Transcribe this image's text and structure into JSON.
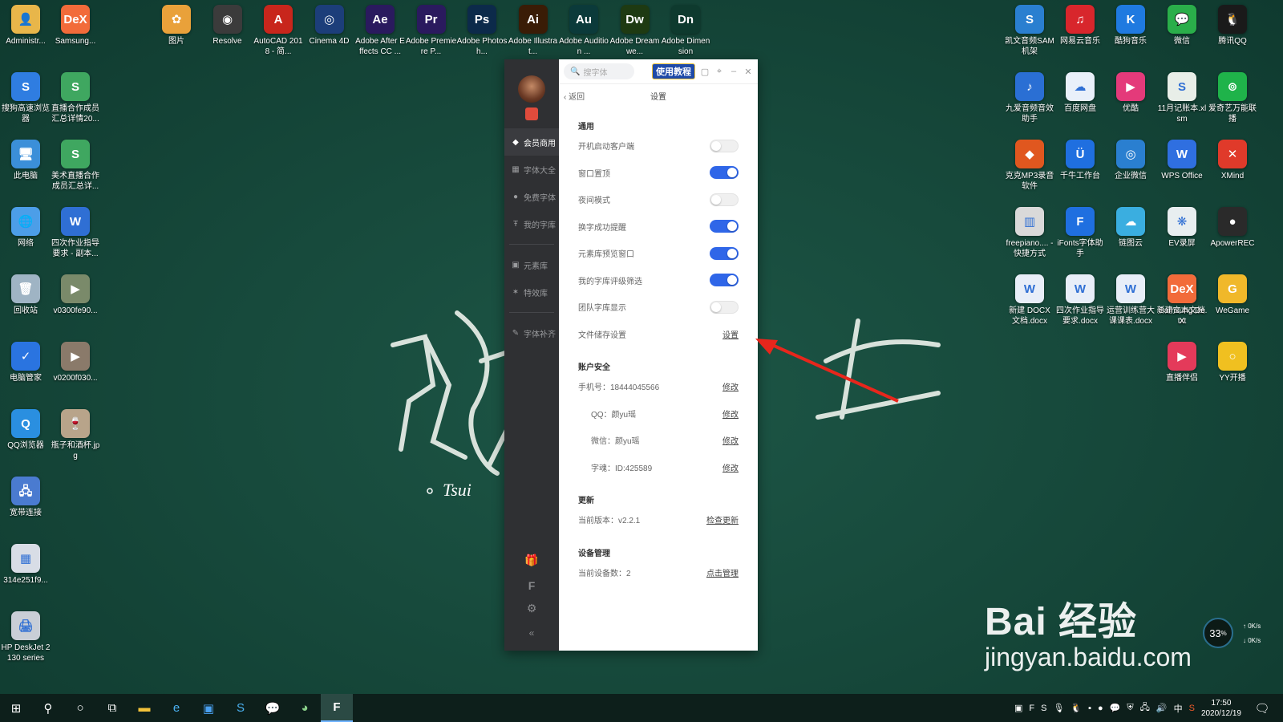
{
  "desktop": {
    "left_icons": [
      {
        "label": "Administr...",
        "color": "#e8b64a",
        "glyph": "👤",
        "icon": "user-folder-icon"
      },
      {
        "label": "Samsung...",
        "color": "#f26b3a",
        "glyph": "DeX",
        "icon": "samsung-dex-icon"
      },
      {
        "label": "搜狗高速浏览器",
        "color": "#2f7de1",
        "glyph": "S",
        "icon": "sogou-browser-icon"
      },
      {
        "label": "直播合作成员汇总详情20...",
        "color": "#3fa760",
        "glyph": "S",
        "icon": "spreadsheet-icon"
      },
      {
        "label": "此电脑",
        "color": "#3b8fd9",
        "glyph": "🖥",
        "icon": "this-pc-icon"
      },
      {
        "label": "美术直播合作成员汇总详...",
        "color": "#3fa760",
        "glyph": "S",
        "icon": "spreadsheet-icon"
      },
      {
        "label": "网络",
        "color": "#4c9ee8",
        "glyph": "🌐",
        "icon": "network-icon"
      },
      {
        "label": "四次作业指导要求 - 副本...",
        "color": "#2f6fd4",
        "glyph": "W",
        "icon": "word-doc-icon"
      },
      {
        "label": "回收站",
        "color": "#9fb4c4",
        "glyph": "🗑",
        "icon": "recycle-bin-icon"
      },
      {
        "label": "v0300fe90...",
        "color": "#7a8a6a",
        "glyph": "▶",
        "icon": "video-file-icon"
      },
      {
        "label": "电脑管家",
        "color": "#2a74e0",
        "glyph": "✓",
        "icon": "pc-manager-icon"
      },
      {
        "label": "v0200f030...",
        "color": "#8a7a6a",
        "glyph": "▶",
        "icon": "video-file-icon"
      },
      {
        "label": "QQ浏览器",
        "color": "#2a8fe0",
        "glyph": "Q",
        "icon": "qq-browser-icon"
      },
      {
        "label": "瓶子和酒杯.jpg",
        "color": "#b8a48a",
        "glyph": "🍷",
        "icon": "image-file-icon"
      },
      {
        "label": "宽带连接",
        "color": "#4a7bd0",
        "glyph": "🖧",
        "icon": "broadband-icon"
      },
      {
        "label": "314e251f9...",
        "color": "#d8dde6",
        "glyph": "▦",
        "icon": "image-file-icon"
      },
      {
        "label": "HP DeskJet 2130 series",
        "color": "#c9ced6",
        "glyph": "🖨",
        "icon": "printer-icon"
      }
    ],
    "top_icons": [
      {
        "label": "图片",
        "color": "#e9a13a",
        "glyph": "✿",
        "icon": "photos-icon"
      },
      {
        "label": "Resolve",
        "color": "#3b3b3b",
        "glyph": "◉",
        "icon": "davinci-resolve-icon"
      },
      {
        "label": "AutoCAD 2018 - 简...",
        "color": "#c8261c",
        "glyph": "A",
        "icon": "autocad-icon"
      },
      {
        "label": "Cinema 4D",
        "color": "#1c3e7a",
        "glyph": "◎",
        "icon": "cinema4d-icon"
      },
      {
        "label": "Adobe After Effects CC ...",
        "color": "#2a1a5e",
        "glyph": "Ae",
        "icon": "after-effects-icon"
      },
      {
        "label": "Adobe Premiere P...",
        "color": "#2a1a5e",
        "glyph": "Pr",
        "icon": "premiere-icon"
      },
      {
        "label": "Adobe Photosh...",
        "color": "#0c2a4a",
        "glyph": "Ps",
        "icon": "photoshop-icon"
      },
      {
        "label": "Adobe Illustrat...",
        "color": "#3a1c06",
        "glyph": "Ai",
        "icon": "illustrator-icon"
      },
      {
        "label": "Adobe Audition ...",
        "color": "#0b3a3a",
        "glyph": "Au",
        "icon": "audition-icon"
      },
      {
        "label": "Adobe Dreamwe...",
        "color": "#1e3a12",
        "glyph": "Dw",
        "icon": "dreamweaver-icon"
      },
      {
        "label": "Adobe Dimension",
        "color": "#0e3a2e",
        "glyph": "Dn",
        "icon": "dimension-icon"
      }
    ],
    "right_icons": [
      {
        "label": "凯文音频SAM机架",
        "color": "#2a7fd0",
        "glyph": "S",
        "icon": "sam-rack-icon"
      },
      {
        "label": "网易云音乐",
        "color": "#d8262c",
        "glyph": "♫",
        "icon": "netease-music-icon"
      },
      {
        "label": "酷狗音乐",
        "color": "#1f7ae0",
        "glyph": "K",
        "icon": "kugou-icon"
      },
      {
        "label": "微信",
        "color": "#2aae4a",
        "glyph": "💬",
        "icon": "wechat-icon"
      },
      {
        "label": "腾讯QQ",
        "color": "#1a1a1a",
        "glyph": "🐧",
        "icon": "qq-icon"
      },
      {
        "label": "九爱音频音效助手",
        "color": "#2a6fd4",
        "glyph": "♪",
        "icon": "audio-helper-icon"
      },
      {
        "label": "百度网盘",
        "color": "#e9f0fa",
        "glyph": "☁",
        "icon": "baidu-netdisk-icon"
      },
      {
        "label": "优酷",
        "color": "#e43a7a",
        "glyph": "▶",
        "icon": "youku-icon"
      },
      {
        "label": "11月记账本.xlsm",
        "color": "#e8eee8",
        "glyph": "S",
        "icon": "spreadsheet-icon"
      },
      {
        "label": "爱奇艺万能联播",
        "color": "#1fb34a",
        "glyph": "⊚",
        "icon": "iqiyi-icon"
      },
      {
        "label": "克克MP3录音软件",
        "color": "#e0571f",
        "glyph": "◆",
        "icon": "mp3-recorder-icon"
      },
      {
        "label": "千牛工作台",
        "color": "#1f6fe0",
        "glyph": "Ü",
        "icon": "qianniu-icon"
      },
      {
        "label": "企业微信",
        "color": "#2a7fd0",
        "glyph": "◎",
        "icon": "wecom-icon"
      },
      {
        "label": "WPS Office",
        "color": "#2f6fe0",
        "glyph": "W",
        "icon": "wps-icon"
      },
      {
        "label": "XMind",
        "color": "#e03a2a",
        "glyph": "✕",
        "icon": "xmind-icon"
      },
      {
        "label": "freepiano.... - 快捷方式",
        "color": "#d9d9d9",
        "glyph": "▥",
        "icon": "freepiano-icon"
      },
      {
        "label": "iFonts字体助手",
        "color": "#1f6fe0",
        "glyph": "F",
        "icon": "ifonts-icon"
      },
      {
        "label": "链图云",
        "color": "#3aaee0",
        "glyph": "☁",
        "icon": "cloud-icon"
      },
      {
        "label": "EV录屏",
        "color": "#e8eef0",
        "glyph": "❋",
        "icon": "ev-recorder-icon"
      },
      {
        "label": "ApowerREC",
        "color": "#2a2a2a",
        "glyph": "●",
        "icon": "apowerrec-icon"
      },
      {
        "label": "新建 DOCX 文档.docx",
        "color": "#e8eef8",
        "glyph": "W",
        "icon": "word-doc-icon"
      },
      {
        "label": "四次作业指导要求.docx",
        "color": "#e8eef8",
        "glyph": "W",
        "icon": "word-doc-icon"
      },
      {
        "label": "运营训练营大课课表.docx",
        "color": "#e8eef8",
        "glyph": "W",
        "icon": "word-doc-icon"
      },
      {
        "label": "新建文本文档.txt",
        "color": "#eeeeee",
        "glyph": "≡",
        "icon": "text-file-icon"
      },
      {
        "label": "Samsung DeX",
        "color": "#f26b3a",
        "glyph": "DeX",
        "icon": "samsung-dex-icon"
      },
      {
        "label": "WeGame",
        "color": "#f0b82a",
        "glyph": "G",
        "icon": "wegame-icon"
      },
      {
        "label": "直播伴侣",
        "color": "#e43a5a",
        "glyph": "▶",
        "icon": "live-companion-icon"
      },
      {
        "label": "YY开播",
        "color": "#f0c020",
        "glyph": "○",
        "icon": "yy-live-icon"
      }
    ],
    "chalk_signature": "Tsui"
  },
  "app": {
    "search_placeholder": "搜字体",
    "tutorial_label": "使用教程",
    "back_label": "返回",
    "page_title": "设置",
    "nav": [
      {
        "label": "会员商用",
        "icon": "diamond-icon",
        "active": true
      },
      {
        "label": "字体大全",
        "icon": "grid-icon",
        "active": false
      },
      {
        "label": "免费字体",
        "icon": "free-icon",
        "active": false
      },
      {
        "label": "我的字库",
        "icon": "font-icon",
        "active": false
      },
      {
        "label": "元素库",
        "icon": "image-icon",
        "active": false
      },
      {
        "label": "特效库",
        "icon": "sparkle-icon",
        "active": false
      },
      {
        "label": "字体补齐",
        "icon": "wrench-icon",
        "active": false
      }
    ],
    "general": {
      "title": "通用",
      "items": [
        {
          "label": "开机启动客户端",
          "on": false
        },
        {
          "label": "窗口置顶",
          "on": true
        },
        {
          "label": "夜间模式",
          "on": false
        },
        {
          "label": "换字成功提醒",
          "on": true
        },
        {
          "label": "元素库预览窗口",
          "on": true
        },
        {
          "label": "我的字库评级筛选",
          "on": true
        },
        {
          "label": "团队字库显示",
          "on": false
        }
      ],
      "storage_label": "文件储存设置",
      "storage_action": "设置"
    },
    "account": {
      "title": "账户安全",
      "phone_label": "手机号：18444045566",
      "qq_label": "QQ：颜yu瑶",
      "wechat_label": "微信：颜yu瑶",
      "zihun_label": "字魂：ID:425589",
      "edit_label": "修改"
    },
    "update": {
      "title": "更新",
      "version_label": "当前版本：v2.2.1",
      "check_label": "检查更新"
    },
    "devices": {
      "title": "设备管理",
      "count_label": "当前设备数：2",
      "manage_label": "点击管理"
    }
  },
  "watermark": {
    "brand": "Bai 经验",
    "url": "jingyan.baidu.com"
  },
  "netspeed": {
    "percent": "33",
    "unit": "%",
    "up": "0K/s",
    "down": "0K/s"
  },
  "taskbar": {
    "time": "17:50",
    "date": "2020/12/19",
    "ime": "中"
  }
}
